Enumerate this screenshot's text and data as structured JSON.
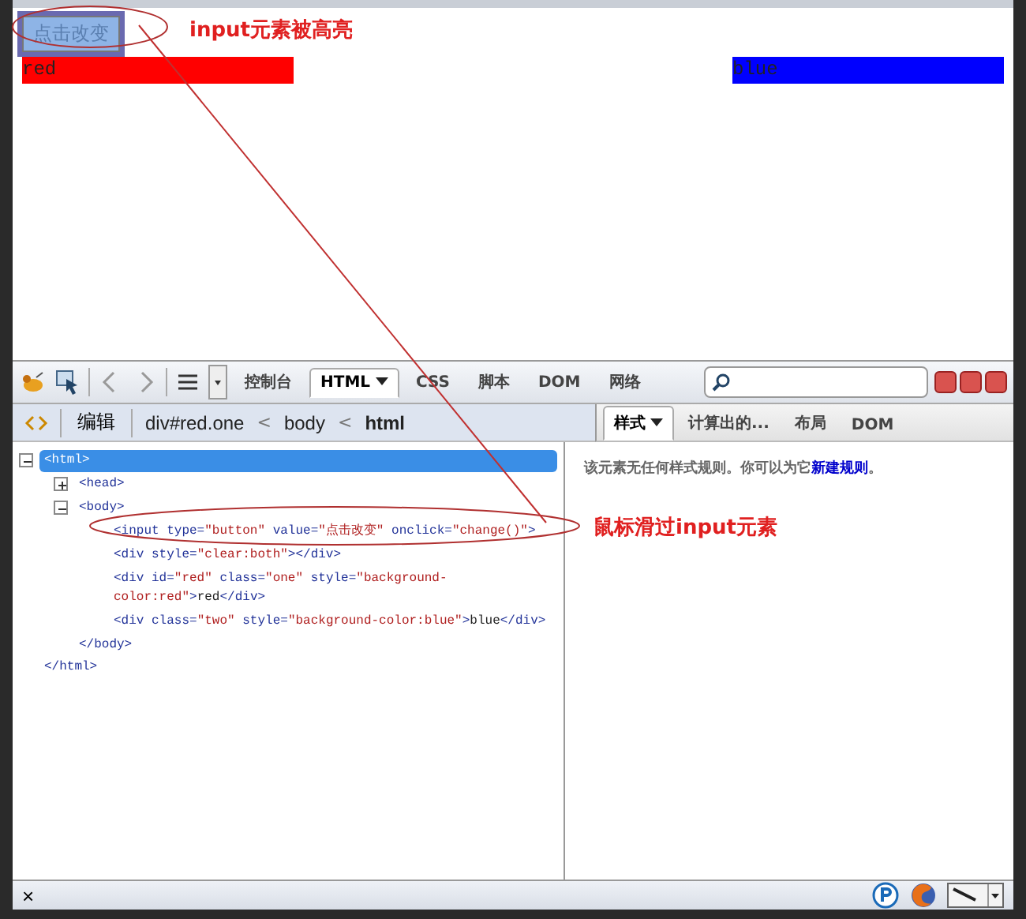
{
  "page": {
    "button": {
      "label": "点击改变",
      "highlighted": true
    },
    "red_block": {
      "text": "red",
      "color": "#ff0000"
    },
    "blue_block": {
      "text": "blue",
      "color": "#0000ff"
    }
  },
  "annotations": [
    {
      "text": "input元素被高亮"
    },
    {
      "text": "鼠标滑过input元素"
    }
  ],
  "toolbar": {
    "tabs": [
      {
        "label": "控制台",
        "selected": false,
        "dropdown": false
      },
      {
        "label": "HTML",
        "selected": true,
        "dropdown": true
      },
      {
        "label": "CSS",
        "selected": false,
        "dropdown": false
      },
      {
        "label": "脚本",
        "selected": false,
        "dropdown": false
      },
      {
        "label": "DOM",
        "selected": false,
        "dropdown": false
      },
      {
        "label": "网络",
        "selected": false,
        "dropdown": false
      }
    ]
  },
  "breadcrumb": {
    "edit": "编辑",
    "items": [
      {
        "text": "div#red.one",
        "selected": false
      },
      {
        "text": "body",
        "selected": false
      },
      {
        "text": "html",
        "selected": true
      }
    ],
    "separator": "<"
  },
  "html_tree": [
    {
      "tokens": [
        {
          "kind": "tag",
          "text": "<html>"
        }
      ],
      "expanded": true,
      "selected": true,
      "closing": "</html>",
      "children": [
        {
          "tokens": [
            {
              "kind": "tag",
              "text": "<head>"
            }
          ],
          "expanded": false,
          "selected": false
        },
        {
          "tokens": [
            {
              "kind": "tag",
              "text": "<body>"
            }
          ],
          "expanded": true,
          "selected": false,
          "closing": "</body>",
          "children": [
            {
              "tokens": [
                {
                  "kind": "tag",
                  "text": "<input type="
                },
                {
                  "kind": "value",
                  "text": "\"button\""
                },
                {
                  "kind": "tag",
                  "text": " value="
                },
                {
                  "kind": "value",
                  "text": "\"点击改变\""
                },
                {
                  "kind": "tag",
                  "text": " onclick="
                },
                {
                  "kind": "value",
                  "text": "\"change()\""
                },
                {
                  "kind": "tag",
                  "text": ">"
                }
              ],
              "selected": false
            },
            {
              "tokens": [
                {
                  "kind": "tag",
                  "text": "<div style="
                },
                {
                  "kind": "value",
                  "text": "\"clear:both\""
                },
                {
                  "kind": "tag",
                  "text": "></div>"
                }
              ],
              "selected": false
            },
            {
              "tokens": [
                {
                  "kind": "tag",
                  "text": "<div id="
                },
                {
                  "kind": "value",
                  "text": "\"red\""
                },
                {
                  "kind": "tag",
                  "text": " class="
                },
                {
                  "kind": "value",
                  "text": "\"one\""
                },
                {
                  "kind": "tag",
                  "text": " style="
                },
                {
                  "kind": "value",
                  "text": "\"background-"
                },
                {
                  "kind": "break"
                },
                {
                  "kind": "value",
                  "text": "color:red\""
                },
                {
                  "kind": "tag",
                  "text": ">"
                },
                {
                  "kind": "text",
                  "text": "red"
                },
                {
                  "kind": "tag",
                  "text": "</div>"
                }
              ],
              "selected": false
            },
            {
              "tokens": [
                {
                  "kind": "tag",
                  "text": "<div class="
                },
                {
                  "kind": "value",
                  "text": "\"two\""
                },
                {
                  "kind": "tag",
                  "text": " style="
                },
                {
                  "kind": "value",
                  "text": "\"background-color:blue\""
                },
                {
                  "kind": "tag",
                  "text": ">"
                },
                {
                  "kind": "text",
                  "text": "blue"
                },
                {
                  "kind": "tag",
                  "text": "</div>"
                }
              ],
              "selected": false
            }
          ]
        }
      ]
    }
  ],
  "side_tabs": [
    {
      "label": "样式",
      "selected": true,
      "dropdown": true
    },
    {
      "label": "计算出的...",
      "selected": false,
      "dropdown": false
    },
    {
      "label": "布局",
      "selected": false,
      "dropdown": false
    },
    {
      "label": "DOM",
      "selected": false,
      "dropdown": false
    }
  ],
  "style_message": {
    "before": "该元素无任何样式规则。你可以为它",
    "link": "新建规则",
    "after": "。"
  },
  "status_bar": {
    "close": "×"
  }
}
